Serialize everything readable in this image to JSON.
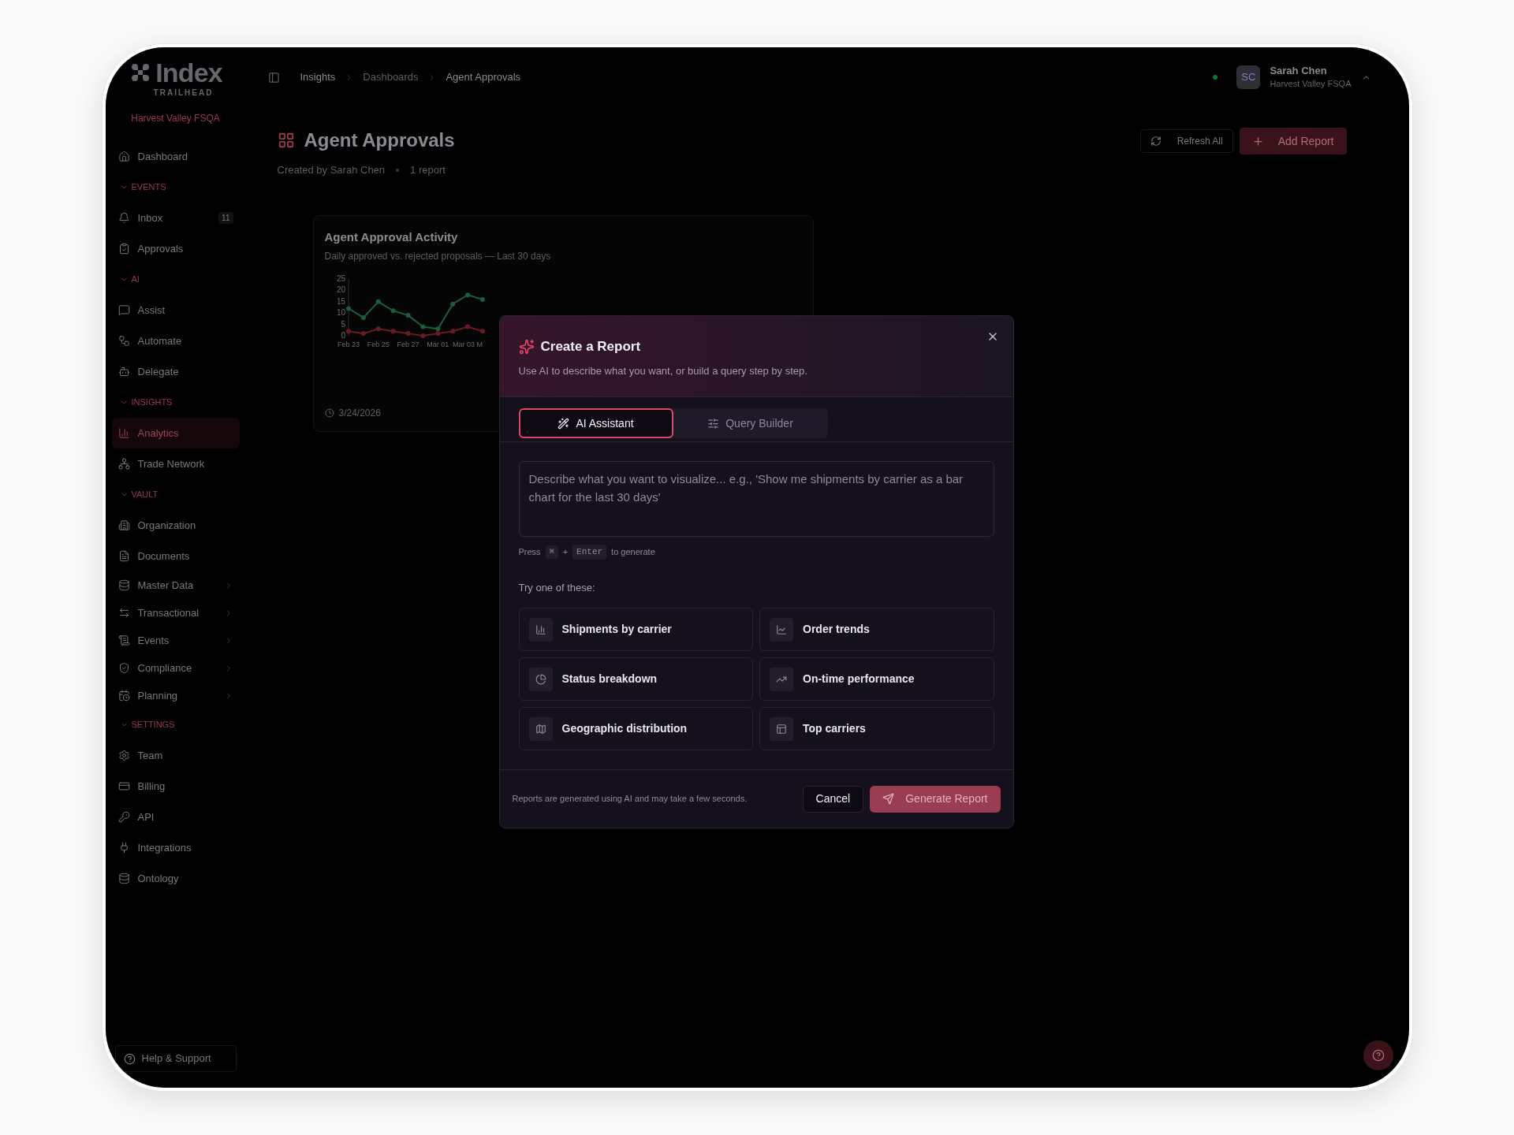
{
  "sidebar": {
    "logo": {
      "name": "Index",
      "tagline": "TRAILHEAD"
    },
    "org": "Harvest Valley FSQA",
    "nav": [
      {
        "kind": "item",
        "label": "Dashboard",
        "selected": false,
        "submenu": false
      },
      {
        "kind": "section",
        "label": "EVENTS",
        "expanded": true,
        "children": [
          {
            "label": "Inbox",
            "selected": false,
            "submenu": false,
            "badge": "11"
          },
          {
            "label": "Approvals",
            "selected": false,
            "submenu": false
          }
        ]
      },
      {
        "kind": "section",
        "label": "AI",
        "expanded": true,
        "children": [
          {
            "label": "Assist",
            "selected": false,
            "submenu": false
          },
          {
            "label": "Automate",
            "selected": false,
            "submenu": false
          },
          {
            "label": "Delegate",
            "selected": false,
            "submenu": false
          }
        ]
      },
      {
        "kind": "section",
        "label": "INSIGHTS",
        "expanded": true,
        "children": [
          {
            "label": "Analytics",
            "selected": true,
            "submenu": false
          },
          {
            "label": "Trade Network",
            "selected": false,
            "submenu": false
          }
        ]
      },
      {
        "kind": "section",
        "label": "VAULT",
        "expanded": true,
        "children": [
          {
            "label": "Organization",
            "selected": false,
            "submenu": false
          },
          {
            "label": "Documents",
            "selected": false,
            "submenu": false
          },
          {
            "label": "Master Data",
            "selected": false,
            "submenu": true
          },
          {
            "label": "Transactional",
            "selected": false,
            "submenu": true
          },
          {
            "label": "Events",
            "selected": false,
            "submenu": true
          },
          {
            "label": "Compliance",
            "selected": false,
            "submenu": true
          },
          {
            "label": "Planning",
            "selected": false,
            "submenu": true
          }
        ]
      },
      {
        "kind": "section",
        "label": "SETTINGS",
        "expanded": true,
        "children": [
          {
            "label": "Team",
            "selected": false,
            "submenu": false
          },
          {
            "label": "Billing",
            "selected": false,
            "submenu": false
          },
          {
            "label": "API",
            "selected": false,
            "submenu": false
          },
          {
            "label": "Integrations",
            "selected": false,
            "submenu": false
          },
          {
            "label": "Ontology",
            "selected": false,
            "submenu": false
          }
        ]
      }
    ],
    "help": "Help & Support"
  },
  "topbar": {
    "breadcrumbs": [
      "Insights",
      "Dashboards",
      "Agent Approvals"
    ],
    "user": {
      "online": true,
      "initials": "SC",
      "name": "Sarah Chen",
      "org": "Harvest Valley FSQA"
    }
  },
  "page": {
    "title": "Agent Approvals",
    "creator": "Created by Sarah Chen",
    "count": "1 report",
    "actions": [
      "Refresh All",
      "Add Report"
    ]
  },
  "report_card": {
    "title": "Agent Approval Activity",
    "subtitle": "Daily approved vs. rejected proposals — Last 30 days",
    "date": "3/24/2026",
    "chart_data": {
      "type": "line",
      "categories": [
        "Feb 23",
        null,
        "Feb 25",
        null,
        "Feb 27",
        null,
        "Mar 01",
        null,
        "Mar 03 M",
        null
      ],
      "ylim": [
        0,
        25
      ],
      "yticks": [
        0,
        5,
        10,
        15,
        20,
        25
      ],
      "series": [
        {
          "color": "#1d5c38",
          "marker": "o",
          "values": [
            12,
            8,
            15,
            11,
            9,
            4,
            3,
            14,
            18,
            16
          ]
        },
        {
          "color": "#6b1a24",
          "marker": "o",
          "values": [
            2,
            1,
            3,
            2,
            1,
            0,
            1,
            2,
            4,
            2
          ]
        }
      ]
    }
  },
  "dialog": {
    "title": "Create a Report",
    "subtitle": "Use AI to describe what you want, or build a query step by step.",
    "tabs": [
      {
        "label": "AI Assistant",
        "selected": true
      },
      {
        "label": "Query Builder",
        "selected": false
      }
    ],
    "prompt": {
      "placeholder": "Describe what you want to visualize... e.g., 'Show me shipments by carrier as a bar chart for the last 30 days'"
    },
    "hint": {
      "before": "Press",
      "keys": [
        "⌘",
        "Enter"
      ],
      "joiner": "+",
      "after": "to generate"
    },
    "suggestions_label": "Try one of these:",
    "suggestions": [
      "Shipments by carrier",
      "Order trends",
      "Status breakdown",
      "On-time performance",
      "Geographic distribution",
      "Top carriers"
    ],
    "footer_note": "Reports are generated using AI and may take a few seconds.",
    "cancel": "Cancel",
    "generate": {
      "label": "Generate Report",
      "disabled": true
    }
  }
}
